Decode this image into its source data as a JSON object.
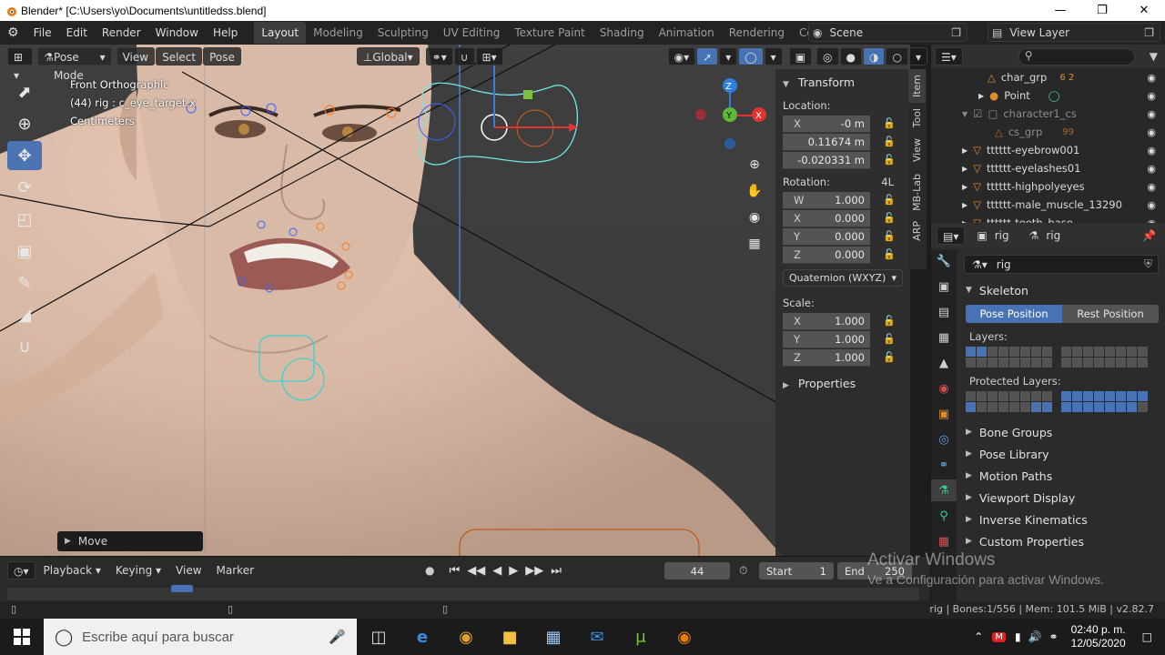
{
  "window": {
    "title": "Blender* [C:\\Users\\yo\\Documents\\untitledss.blend]"
  },
  "menu": [
    "File",
    "Edit",
    "Render",
    "Window",
    "Help"
  ],
  "workspaces": [
    "Layout",
    "Modeling",
    "Sculpting",
    "UV Editing",
    "Texture Paint",
    "Shading",
    "Animation",
    "Rendering",
    "Compositing"
  ],
  "scene": "Scene",
  "view_layer": "View Layer",
  "viewport_header": {
    "mode": "Pose Mode",
    "view": "View",
    "select": "Select",
    "pose": "Pose",
    "orientation": "Global"
  },
  "viewport_info": {
    "view_name": "Front Orthographic",
    "object": "(44) rig : c_eye_target.x",
    "units": "Centimeters"
  },
  "last_operator": "Move",
  "transform_panel": {
    "title": "Transform",
    "location_label": "Location:",
    "location": [
      {
        "axis": "X",
        "value": "-0 m"
      },
      {
        "axis": "",
        "value": "0.11674 m"
      },
      {
        "axis": "",
        "value": "-0.020331 m"
      }
    ],
    "rotation_label": "Rotation:",
    "rotation_mode_badge": "4L",
    "rotation": [
      {
        "axis": "W",
        "value": "1.000"
      },
      {
        "axis": "X",
        "value": "0.000"
      },
      {
        "axis": "Y",
        "value": "0.000"
      },
      {
        "axis": "Z",
        "value": "0.000"
      }
    ],
    "rotation_mode": "Quaternion (WXYZ)",
    "scale_label": "Scale:",
    "scale": [
      {
        "axis": "X",
        "value": "1.000"
      },
      {
        "axis": "Y",
        "value": "1.000"
      },
      {
        "axis": "Z",
        "value": "1.000"
      }
    ],
    "properties_label": "Properties"
  },
  "sidebar_tabs": [
    "Item",
    "Tool",
    "View",
    "MB-Lab",
    "ARP"
  ],
  "outliner": {
    "rows": [
      {
        "name": "char_grp",
        "badge": "6 2",
        "dim": false
      },
      {
        "name": "Point",
        "badge": "",
        "dim": false
      },
      {
        "name": "character1_cs",
        "badge": "",
        "dim": true
      },
      {
        "name": "cs_grp",
        "badge": "99",
        "dim": true
      },
      {
        "name": "tttttt-eyebrow001",
        "badge": "",
        "dim": false
      },
      {
        "name": "tttttt-eyelashes01",
        "badge": "",
        "dim": false
      },
      {
        "name": "tttttt-highpolyeyes",
        "badge": "",
        "dim": false
      },
      {
        "name": "tttttt-male_muscle_13290",
        "badge": "",
        "dim": false
      },
      {
        "name": "tttttt-teeth_base",
        "badge": "",
        "dim": false
      }
    ]
  },
  "properties": {
    "breadcrumb_object": "rig",
    "breadcrumb_data": "rig",
    "data_name": "rig",
    "skeleton_title": "Skeleton",
    "pose_position": "Pose Position",
    "rest_position": "Rest Position",
    "layers_label": "Layers:",
    "protected_layers_label": "Protected Layers:",
    "sections": [
      "Bone Groups",
      "Pose Library",
      "Motion Paths",
      "Viewport Display",
      "Inverse Kinematics",
      "Custom Properties"
    ]
  },
  "timeline": {
    "playback": "Playback",
    "keying": "Keying",
    "view": "View",
    "marker": "Marker",
    "current_frame": "44",
    "start_label": "Start",
    "start_value": "1",
    "end_label": "End",
    "end_value": "250"
  },
  "statusbar": {
    "stats": "rig | Bones:1/556 | Mem: 101.5 MiB | v2.82.7"
  },
  "activation": {
    "line1": "Activar Windows",
    "line2": "Ve a Configuración para activar Windows."
  },
  "taskbar": {
    "search_placeholder": "Escribe aquí para buscar",
    "time": "02:40 p. m.",
    "date": "12/05/2020"
  },
  "colors": {
    "accent": "#4772b3",
    "skin": "#cdb29c",
    "active_tool": "#4c74b4"
  }
}
